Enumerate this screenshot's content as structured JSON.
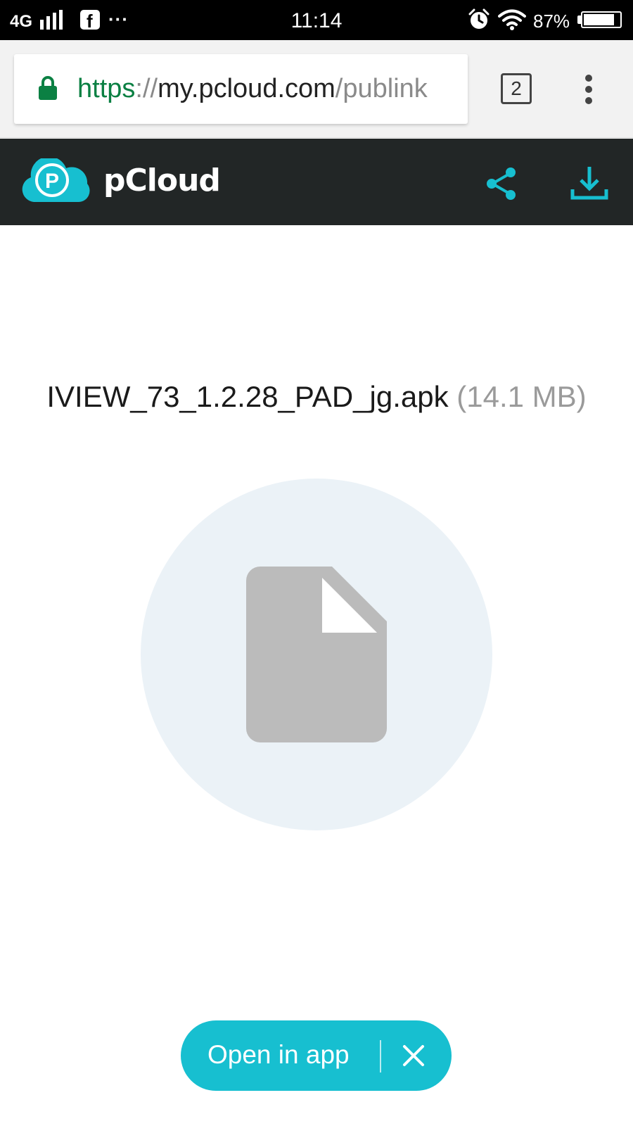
{
  "status_bar": {
    "network": "4G",
    "signal_icon": "cellular-signal-icon",
    "notification_icon": "facebook-icon",
    "more_notifications": "···",
    "time": "11:14",
    "alarm_icon": "alarm-icon",
    "wifi_icon": "wifi-icon",
    "battery_percent": "87%",
    "battery_level": 0.87
  },
  "browser": {
    "url_scheme": "https",
    "url_separator": "://",
    "url_host": "my.pcloud.com",
    "url_path": "/publink",
    "tab_count": "2",
    "lock_icon": "lock-icon",
    "menu_icon": "overflow-menu-icon",
    "scheme_color": "#0b8043"
  },
  "app_header": {
    "brand": "pCloud",
    "logo_letter": "P",
    "share_icon": "share-icon",
    "download_icon": "download-icon",
    "accent_color": "#17bfd0"
  },
  "file": {
    "name": "IVIEW_73_1.2.28_PAD_jg.apk",
    "size": "(14.1 MB)",
    "icon": "file-icon"
  },
  "open_in_app": {
    "label": "Open in app",
    "close_icon": "close-icon"
  }
}
